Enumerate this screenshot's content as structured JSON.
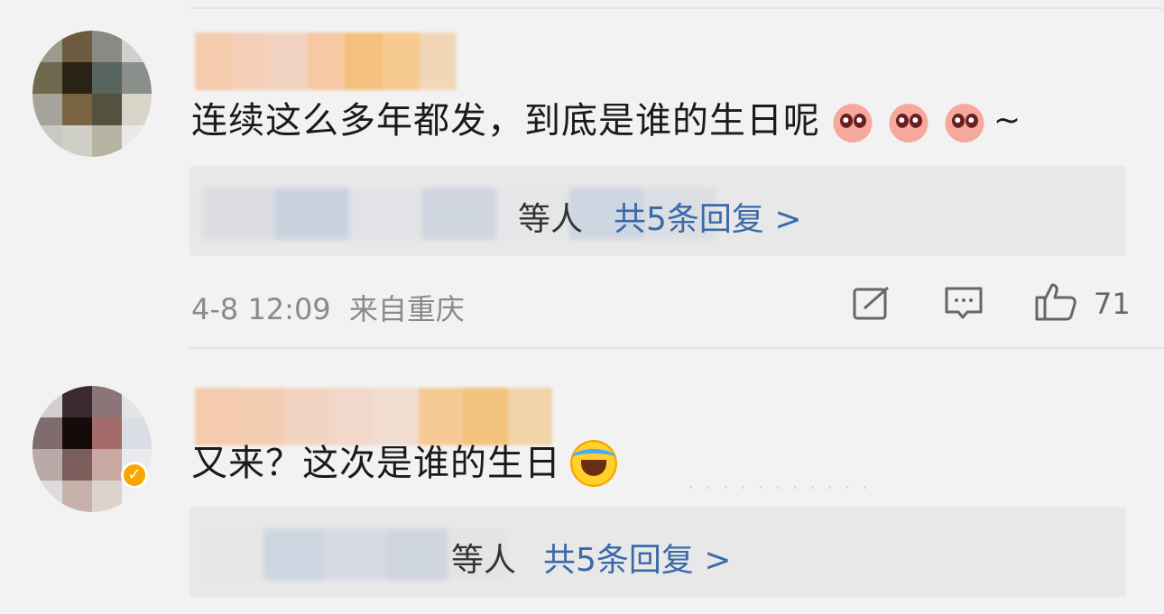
{
  "comments": [
    {
      "text": "连续这么多年都发，到底是谁的生日呢",
      "emoji": [
        "heart-eyes-emoji",
        "heart-eyes-emoji",
        "heart-eyes-emoji"
      ],
      "trailing": "~",
      "replies": {
        "others_label": "等人",
        "count_label": "共5条回复 >"
      },
      "meta": {
        "time": "4-8 12:09",
        "location": "来自重庆"
      },
      "likes": "71"
    },
    {
      "text": "又来？这次是谁的生日",
      "emoji": [
        "laugh-cry-emoji"
      ],
      "replies": {
        "others_label": "等人",
        "count_label": "共5条回复 >"
      },
      "verified": true
    }
  ],
  "icons": {
    "share": "share-icon",
    "comment": "comment-icon",
    "like": "thumbs-up-icon"
  }
}
